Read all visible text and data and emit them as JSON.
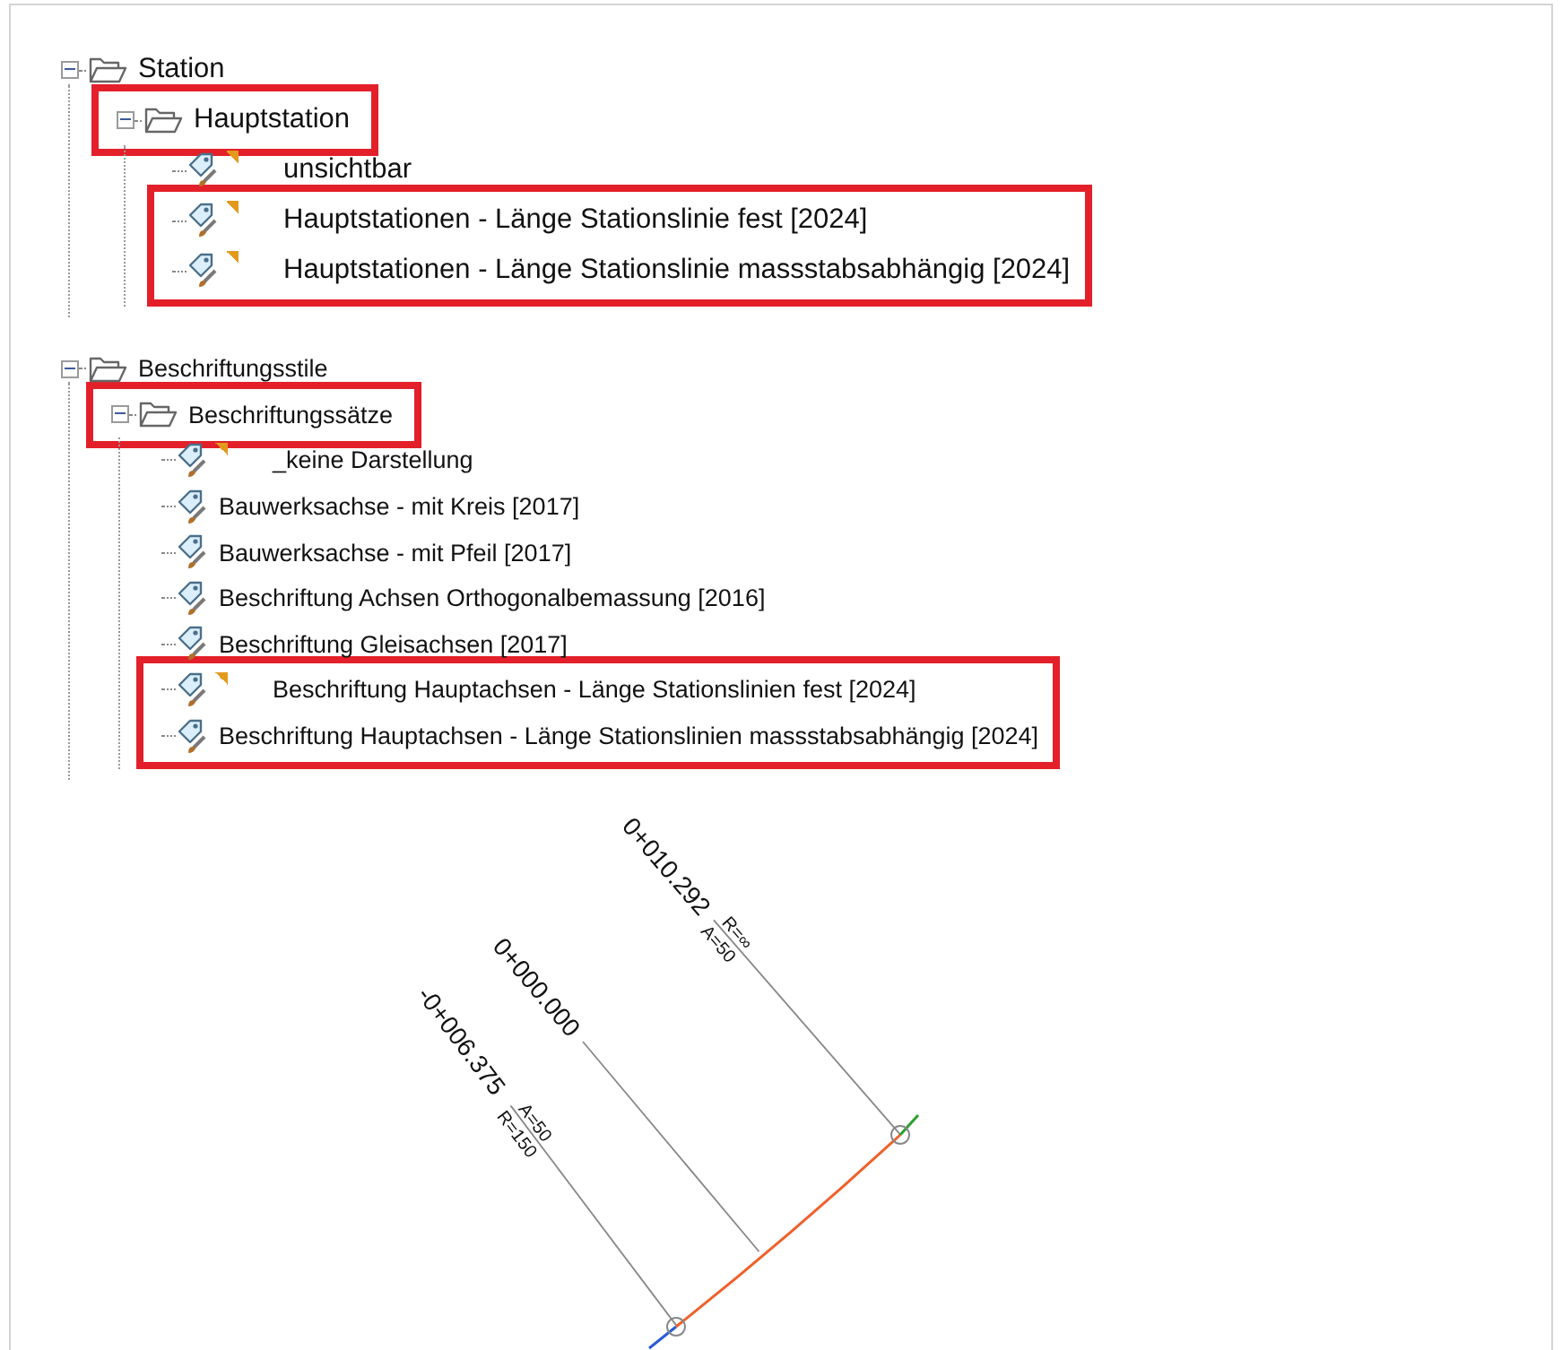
{
  "trees": [
    {
      "label": "Station",
      "expanded": true,
      "highlighted": false,
      "children": [
        {
          "label": "Hauptstation",
          "expanded": true,
          "highlighted": true,
          "children": [
            {
              "label": "unsichtbar",
              "flag": true,
              "highlighted": false
            },
            {
              "label": "Hauptstationen - Länge Stationslinie fest [2024]",
              "flag": true,
              "highlighted": true
            },
            {
              "label": "Hauptstationen - Länge Stationslinie massstabsabhängig [2024]",
              "flag": true,
              "highlighted": true
            }
          ]
        }
      ]
    },
    {
      "label": "Beschriftungsstile",
      "expanded": true,
      "highlighted": false,
      "children": [
        {
          "label": "Beschriftungssätze",
          "expanded": true,
          "highlighted": true,
          "children": [
            {
              "label": "_keine Darstellung",
              "flag": true,
              "highlighted": false
            },
            {
              "label": "Bauwerksachse - mit Kreis [2017]",
              "flag": false,
              "highlighted": false
            },
            {
              "label": "Bauwerksachse - mit Pfeil [2017]",
              "flag": false,
              "highlighted": false
            },
            {
              "label": "Beschriftung Achsen Orthogonalbemassung [2016]",
              "flag": false,
              "highlighted": false
            },
            {
              "label": "Beschriftung Gleisachsen [2017]",
              "flag": false,
              "highlighted": false
            },
            {
              "label": "Beschriftung Hauptachsen - Länge Stationslinien fest [2024]",
              "flag": true,
              "highlighted": true
            },
            {
              "label": "Beschriftung Hauptachsen - Länge Stationslinien massstabsabhängig [2024]",
              "flag": false,
              "highlighted": true
            }
          ]
        }
      ]
    }
  ],
  "drawing": {
    "stations": [
      {
        "label": "-0+006.375",
        "upper": "A=50",
        "lower": "R=150"
      },
      {
        "label": "0+000.000"
      },
      {
        "label": "0+010.292",
        "upper": "R=∞",
        "lower": "A=50"
      }
    ]
  }
}
